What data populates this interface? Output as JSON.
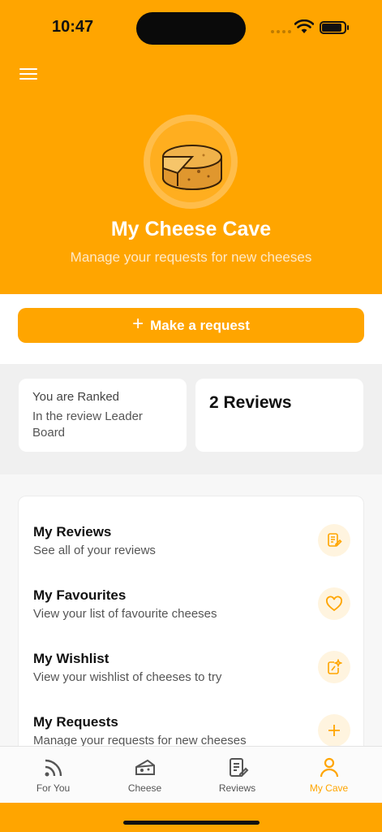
{
  "status_bar": {
    "time": "10:47"
  },
  "header": {
    "title": "My Cheese Cave",
    "subtitle": "Manage your requests for new cheeses",
    "avatar_icon": "cheese-wheel-icon"
  },
  "request_button": {
    "label": "Make a request",
    "icon": "plus-icon"
  },
  "stats": {
    "rank_heading": "You are Ranked",
    "rank_text": "In the review Leader Board",
    "reviews_count": "2 Reviews"
  },
  "list": {
    "items": [
      {
        "title": "My Reviews",
        "subtitle": "See all of your reviews",
        "icon": "edit-note-icon"
      },
      {
        "title": "My Favourites",
        "subtitle": "View your list of favourite cheeses",
        "icon": "heart-icon"
      },
      {
        "title": "My Wishlist",
        "subtitle": "View your wishlist of cheeses to try",
        "icon": "sparkle-note-icon"
      },
      {
        "title": "My Requests",
        "subtitle": "Manage your requests for new cheeses",
        "icon": "plus-icon"
      }
    ]
  },
  "tabs": [
    {
      "label": "For You",
      "icon": "feed-icon",
      "active": false
    },
    {
      "label": "Cheese",
      "icon": "cheese-icon",
      "active": false
    },
    {
      "label": "Reviews",
      "icon": "document-edit-icon",
      "active": false
    },
    {
      "label": "My Cave",
      "icon": "person-icon",
      "active": true
    }
  ],
  "colors": {
    "accent": "#ffa500",
    "icon_bg": "#fff4df"
  }
}
